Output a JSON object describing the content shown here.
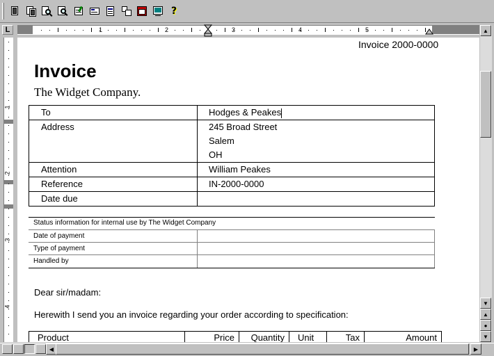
{
  "toolbar": {
    "buttons": [
      {
        "name": "new-document-icon"
      },
      {
        "name": "multiple-pages-icon"
      },
      {
        "name": "zoom-icon"
      },
      {
        "name": "print-preview-icon"
      },
      {
        "name": "edit-page-icon"
      },
      {
        "name": "outline-left-icon"
      },
      {
        "name": "outline-right-icon"
      },
      {
        "name": "move-block-icon"
      },
      {
        "name": "calendar-insert-icon"
      },
      {
        "name": "screen-image-icon"
      },
      {
        "name": "help-icon"
      }
    ],
    "help_glyph": "?"
  },
  "ruler": {
    "corner_glyph": "L",
    "numbers": [
      "1",
      "2",
      "3",
      "4",
      "5"
    ],
    "vertical_numbers": [
      "1",
      "2",
      "3",
      "4"
    ]
  },
  "document": {
    "header_invoice_no": "Invoice 2000-0000",
    "title": "Invoice",
    "company": "The Widget Company.",
    "info_rows": [
      {
        "key": "To",
        "values": [
          "Hodges & Peakes"
        ]
      },
      {
        "key": "Address",
        "values": [
          "245 Broad Street",
          "Salem",
          "OH"
        ]
      },
      {
        "key": "Attention",
        "values": [
          "William Peakes"
        ]
      },
      {
        "key": "Reference",
        "values": [
          "IN-2000-0000"
        ]
      },
      {
        "key": "Date due",
        "values": [
          ""
        ]
      }
    ],
    "status_title": "Status information for internal use by The Widget Company",
    "status_rows": [
      "Date of payment",
      "Type of payment",
      "Handled by"
    ],
    "greeting": "Dear sir/madam:",
    "intro": "Herewith I send you an invoice regarding your order according to specification:",
    "product_headers": [
      "Product",
      "Price",
      "Quantity",
      "Unit",
      "Tax",
      "Amount"
    ]
  }
}
